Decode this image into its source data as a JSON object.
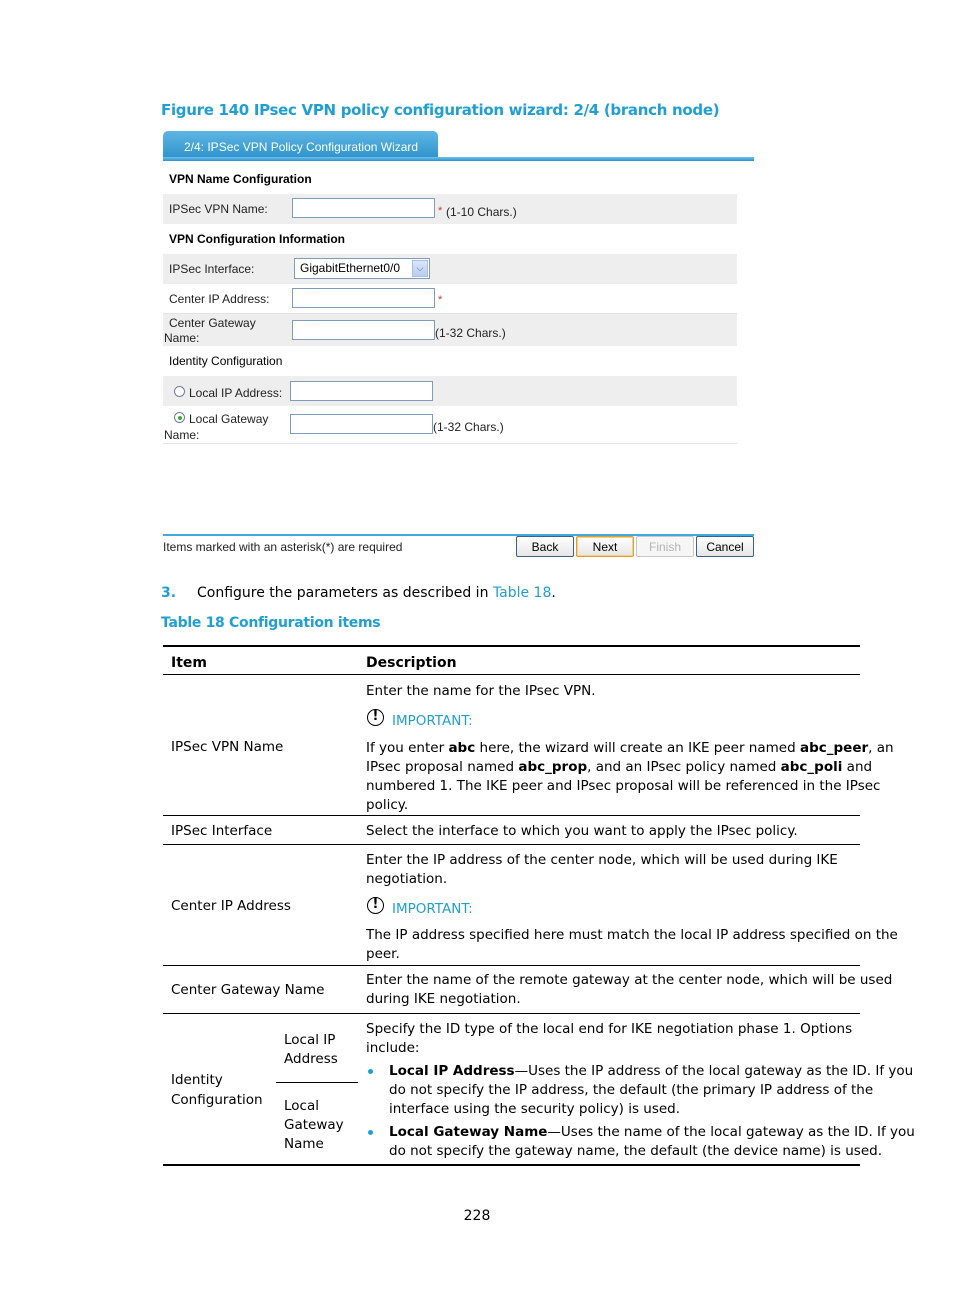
{
  "figure_title": "Figure 140 IPsec VPN policy configuration wizard: 2/4 (branch node)",
  "wizard": {
    "tab_label": "2/4: IPSec VPN Policy Configuration Wizard",
    "sections": {
      "vpn_name": "VPN Name Configuration",
      "vpn_config": "VPN Configuration Information",
      "identity": "Identity Configuration"
    },
    "fields": {
      "ipsec_vpn_name": {
        "label": "IPSec VPN Name:",
        "value": "",
        "required_mark": "*",
        "hint": "(1-10 Chars.)"
      },
      "ipsec_interface": {
        "label": "IPSec Interface:",
        "selected": "GigabitEthernet0/0"
      },
      "center_ip": {
        "label": "Center IP Address:",
        "value": "",
        "required_mark": "*"
      },
      "center_gateway_name": {
        "label_line1": "Center Gateway",
        "label_line2": "Name:",
        "value": "",
        "hint": "(1-32 Chars.)"
      },
      "local_ip": {
        "label": "Local IP Address:",
        "value": "",
        "selected": false
      },
      "local_gateway_name": {
        "label_line1": "Local Gateway",
        "label_line2": "Name:",
        "value": "",
        "hint": "(1-32 Chars.)",
        "selected": true
      }
    },
    "footer_note": "Items marked with an asterisk(*) are required",
    "buttons": {
      "back": "Back",
      "next": "Next",
      "finish": "Finish",
      "cancel": "Cancel"
    }
  },
  "step": {
    "number": "3.",
    "text_before": "Configure the parameters as described in ",
    "link": "Table 18",
    "text_after": "."
  },
  "table": {
    "title": "Table 18 Configuration items",
    "headers": {
      "item": "Item",
      "description": "Description"
    },
    "important_label": "IMPORTANT:",
    "rows": {
      "vpn_name": {
        "item": "IPSec VPN Name",
        "desc1": "Enter the name for the IPsec VPN.",
        "imp_l1_a": "If you enter ",
        "imp_l1_b": "abc",
        "imp_l1_c": " here, the wizard will create an IKE peer named ",
        "imp_l1_d": "abc_peer",
        "imp_l1_e": ", an",
        "imp_l2_a": "IPsec proposal named ",
        "imp_l2_b": "abc_prop",
        "imp_l2_c": ", and an IPsec policy named ",
        "imp_l2_d": "abc_poli",
        "imp_l2_e": " and",
        "imp_l3": "numbered 1. The IKE peer and IPsec proposal will be referenced in the IPsec",
        "imp_l4": "policy."
      },
      "interface": {
        "item": "IPSec Interface",
        "desc": "Select the interface to which you want to apply the IPsec policy."
      },
      "center_ip": {
        "item": "Center IP Address",
        "desc_l1": "Enter the IP address of the center node, which will be used during IKE",
        "desc_l2": "negotiation.",
        "imp_l1": "The IP address specified here must match the local IP address specified on the",
        "imp_l2": "peer."
      },
      "center_gw": {
        "item": "Center Gateway Name",
        "desc_l1": "Enter the name of the remote gateway at the center node, which will be used",
        "desc_l2": "during IKE negotiation."
      },
      "identity": {
        "item_l1": "Identity",
        "item_l2": "Configuration",
        "sub1_l1": "Local IP",
        "sub1_l2": "Address",
        "sub2_l1": "Local",
        "sub2_l2": "Gateway",
        "sub2_l3": "Name",
        "desc_l1": "Specify the ID type of the local end for IKE negotiation phase 1. Options",
        "desc_l2": "include:",
        "b1_bold": "Local IP Address",
        "b1_l1": "—Uses the IP address of the local gateway as the ID. If you",
        "b1_l2": "do not specify the IP address, the default (the primary IP address of the",
        "b1_l3": "interface using the security policy) is used.",
        "b2_bold": "Local Gateway Name",
        "b2_l1": "—Uses the name of the local gateway as the ID. If you",
        "b2_l2": "do not specify the gateway name, the default (the device name) is used."
      }
    }
  },
  "page_number": "228"
}
